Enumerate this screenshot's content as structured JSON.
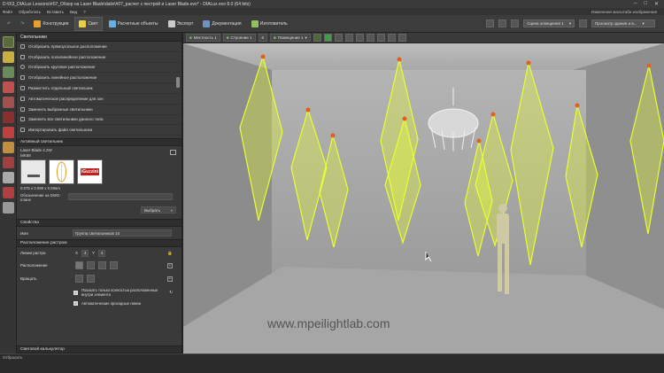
{
  "window": {
    "title": "D:\\0\\3_DIALux Lessons\\#07_Обзор на Laser Blade\\dalix\\#07_расчет с пестрой и Laser Blade.evo* - DIALux evo 8.0 (64 bits)",
    "controls": [
      "–",
      "□",
      "✕"
    ]
  },
  "menu": {
    "items": [
      "Файл",
      "Обработать",
      "Вставить",
      "Вид",
      "?"
    ],
    "right": "Изменение масштаба изображения"
  },
  "toolbar": {
    "items": [
      {
        "label": "Конструкция",
        "icon": "construction-icon",
        "color": "#e8a030"
      },
      {
        "label": "Свет",
        "icon": "light-icon",
        "color": "#e8d040",
        "active": true
      },
      {
        "label": "Расчетные объекты",
        "icon": "calc-objects-icon",
        "color": "#6ab0e0"
      },
      {
        "label": "Экспорт",
        "icon": "export-icon",
        "color": "#cccccc"
      },
      {
        "label": "Документация",
        "icon": "documentation-icon",
        "color": "#7090c0"
      },
      {
        "label": "Изготовитель",
        "icon": "manufacturer-icon",
        "color": "#90c060"
      }
    ],
    "scene_select": "Сцена освещения 1",
    "scene_select2": "Просмотр здания и в..."
  },
  "panel": {
    "title": "Светильники",
    "actions": [
      "Отобразить прямоугольное расположение",
      "Отобразить полилинейное расположение",
      "Отобразить круговое расположение",
      "Отобразить линейное расположение",
      "Разместить отдельный светильник",
      "Автоматическое распределение для зон",
      "Заменить выбранные светильники",
      "Заменить все светильники данного типа",
      "Импортировать файл светильника"
    ],
    "active_head": "Активный светильник",
    "lum_name": "Laser Blade 4.2W",
    "lum_code": "MK88",
    "lum_dims": "0.075 x 0.099 x 0.096m",
    "brand": "iGuzzini",
    "dwg_label": "Обозначение на DWG-",
    "dwg_label2": "плане",
    "dwg_value": "",
    "select_button": "Выбрать",
    "props_head": "Свойства",
    "name_label": "Имя",
    "name_value": "Группа светильников 10",
    "layout_head": "Расположение растром",
    "raster_label": "Линии растра",
    "x_label": "X",
    "x_value": "4",
    "y_label": "Y",
    "y_value": "4",
    "arrangement_label": "Расположение",
    "rotate_label": "Вращать",
    "check1": "Показать только полностью расположенные внутри элемента",
    "check2": "Автоматические проходные линии",
    "calc_head": "Световой калькулятор"
  },
  "viewport_bar": {
    "tabs": [
      "Местность 1",
      "Строение 1",
      "6",
      "Помещение 1"
    ]
  },
  "viewport": {
    "watermark": "www.mpeilightlab.com"
  },
  "status": {
    "text": "Отбросить"
  },
  "colors": {
    "accent": "#3aa040",
    "luminaire": "#e8ff30",
    "bg": "#2b2b2b"
  }
}
